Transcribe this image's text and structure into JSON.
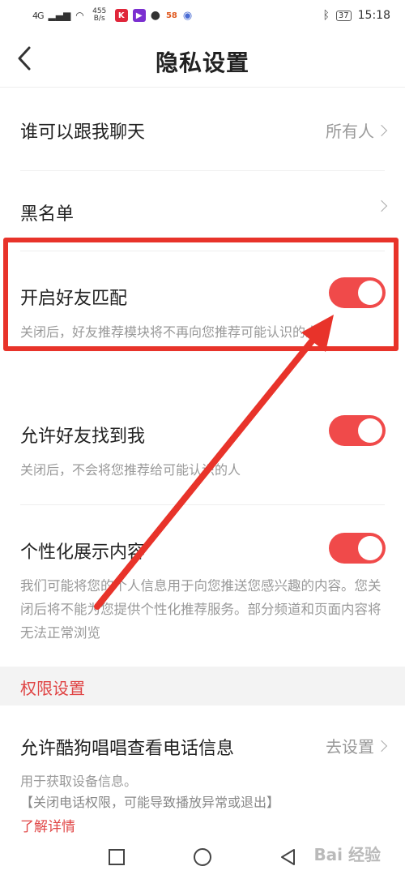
{
  "status_bar": {
    "signal": "4G",
    "net_speed": "455\nB/s",
    "apps": [
      "K",
      "▶",
      "58"
    ],
    "battery": "37",
    "time": "15:18"
  },
  "header": {
    "title": "隐私设置"
  },
  "rows": {
    "chat": {
      "label": "谁可以跟我聊天",
      "value": "所有人"
    },
    "blacklist": {
      "label": "黑名单"
    },
    "friend_match": {
      "label": "开启好友匹配",
      "desc": "关闭后，好友推荐模块将不再向您推荐可能认识的人",
      "enabled": true
    },
    "find_me": {
      "label": "允许好友找到我",
      "desc": "关闭后，不会将您推荐给可能认识的人",
      "enabled": true
    },
    "personalized": {
      "label": "个性化展示内容",
      "desc": "我们可能将您的个人信息用于向您推送您感兴趣的内容。您关闭后将不能为您提供个性化推荐服务。部分频道和页面内容将无法正常浏览",
      "enabled": true
    }
  },
  "permissions": {
    "section_title": "权限设置",
    "phone": {
      "label": "允许酷狗唱唱查看电话信息",
      "value": "去设置",
      "desc_line1": "用于获取设备信息。",
      "desc_line2": "【关闭电话权限，可能导致播放异常或退出】",
      "link": "了解详情"
    }
  },
  "watermark": "Bai 经验",
  "colors": {
    "accent": "#f04a4a",
    "annotation": "#e8332a"
  }
}
